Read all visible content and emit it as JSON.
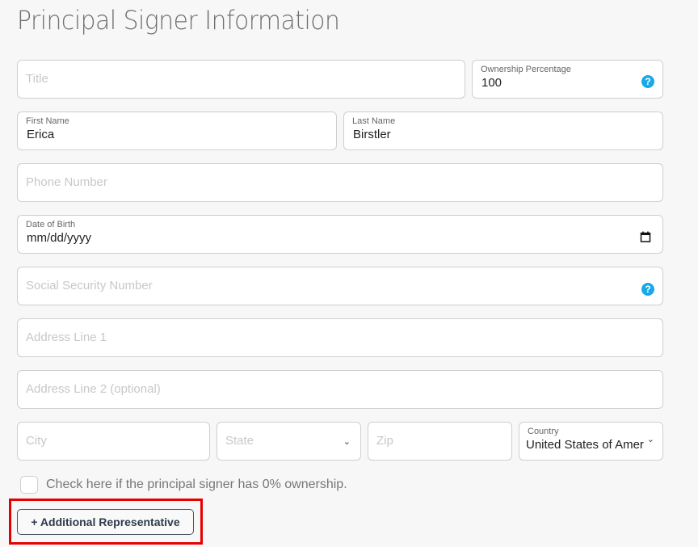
{
  "page": {
    "title": "Principal Signer Information"
  },
  "fields": {
    "title": {
      "placeholder": "Title",
      "value": ""
    },
    "ownership": {
      "label": "Ownership Percentage",
      "value": "100",
      "help": "?"
    },
    "first_name": {
      "label": "First Name",
      "value": "Erica"
    },
    "last_name": {
      "label": "Last Name",
      "value": "Birstler"
    },
    "phone": {
      "placeholder": "Phone Number",
      "value": ""
    },
    "dob": {
      "label": "Date of Birth",
      "value": "mm/dd/yyyy"
    },
    "ssn": {
      "placeholder": "Social Security Number",
      "value": "",
      "help": "?"
    },
    "address1": {
      "placeholder": "Address Line 1",
      "value": ""
    },
    "address2": {
      "placeholder": "Address Line 2 (optional)",
      "value": ""
    },
    "city": {
      "placeholder": "City",
      "value": ""
    },
    "state": {
      "placeholder": "State",
      "value": ""
    },
    "zip": {
      "placeholder": "Zip",
      "value": ""
    },
    "country": {
      "label": "Country",
      "value": "United States of Amer"
    }
  },
  "zero_ownership": {
    "label": "Check here if the principal signer has 0% ownership.",
    "checked": false
  },
  "actions": {
    "add_representative": "+ Additional Representative"
  },
  "colors": {
    "help_icon": "#1aa9e8",
    "highlight": "#e80000",
    "button_border": "#4a5360"
  }
}
